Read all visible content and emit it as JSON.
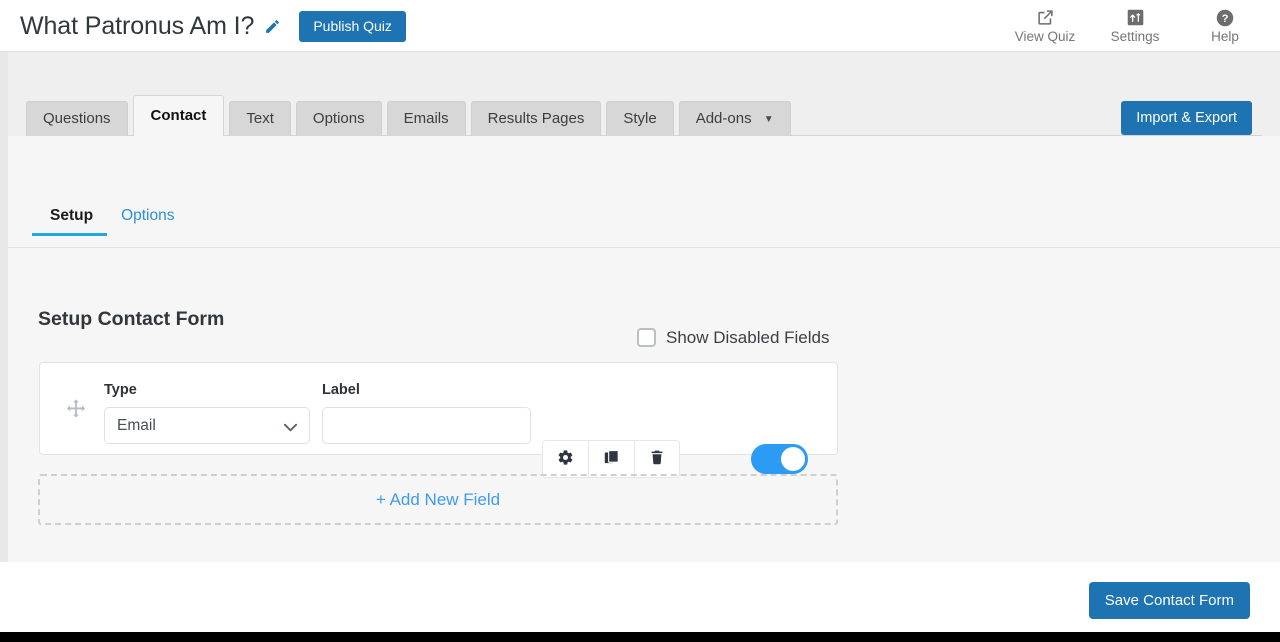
{
  "header": {
    "quiz_title": "What Patronus Am I?",
    "edit_icon": "pencil-icon",
    "publish_label": "Publish Quiz",
    "actions": [
      {
        "label": "View Quiz",
        "icon": "external-link-icon"
      },
      {
        "label": "Settings",
        "icon": "sliders-icon"
      },
      {
        "label": "Help",
        "icon": "question-circle-icon"
      }
    ]
  },
  "tabs": {
    "items": [
      {
        "label": "Questions",
        "active": false,
        "has_caret": false
      },
      {
        "label": "Contact",
        "active": true,
        "has_caret": false
      },
      {
        "label": "Text",
        "active": false,
        "has_caret": false
      },
      {
        "label": "Options",
        "active": false,
        "has_caret": false
      },
      {
        "label": "Emails",
        "active": false,
        "has_caret": false
      },
      {
        "label": "Results Pages",
        "active": false,
        "has_caret": false
      },
      {
        "label": "Style",
        "active": false,
        "has_caret": false
      },
      {
        "label": "Add-ons",
        "active": false,
        "has_caret": true,
        "caret": "▼"
      }
    ],
    "import_export_label": "Import & Export"
  },
  "subtabs": {
    "items": [
      {
        "label": "Setup",
        "active": true
      },
      {
        "label": "Options",
        "active": false
      }
    ]
  },
  "main": {
    "heading": "Setup Contact Form",
    "show_disabled_fields_label": "Show Disabled Fields",
    "show_disabled_fields_checked": false,
    "field_row": {
      "drag_handle_icon": "move-arrows-icon",
      "type_label": "Type",
      "type_value": "Email",
      "type_options": [
        "Email"
      ],
      "label_label": "Label",
      "label_value": "",
      "label_placeholder": "",
      "actions": [
        {
          "icon": "gear-icon",
          "name": "field-settings-button"
        },
        {
          "icon": "copy-icon",
          "name": "field-duplicate-button"
        },
        {
          "icon": "trash-icon",
          "name": "field-delete-button"
        }
      ],
      "toggle_enabled": true
    },
    "add_new_field_label": "+ Add New Field"
  },
  "footer": {
    "save_label": "Save Contact Form"
  },
  "colors": {
    "brand_blue": "#1e73b3",
    "link_blue": "#2c8fd4",
    "accent_cyan": "#21a7e0",
    "toggle_blue": "#2b9bf3",
    "add_field_blue": "#3f9bef",
    "content_bg": "#efefef",
    "panel_bg": "#f6f6f6"
  }
}
